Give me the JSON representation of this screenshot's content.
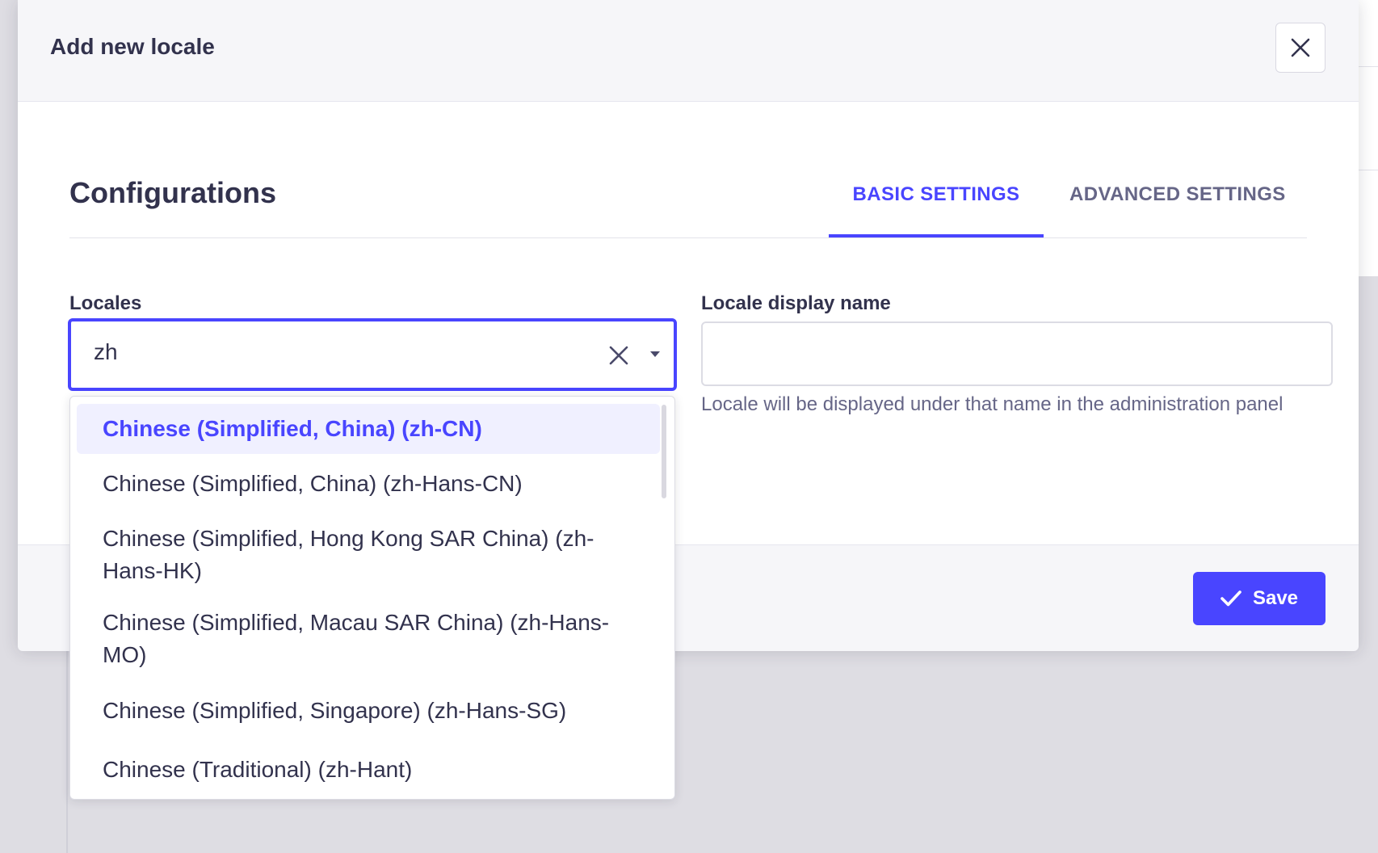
{
  "modal": {
    "title": "Add new locale"
  },
  "configurations": {
    "title": "Configurations",
    "tabs": [
      {
        "label": "BASIC SETTINGS",
        "active": true
      },
      {
        "label": "ADVANCED SETTINGS",
        "active": false
      }
    ]
  },
  "locales_field": {
    "label": "Locales",
    "value": "zh"
  },
  "display_name_field": {
    "label": "Locale display name",
    "value": "",
    "hint": "Locale will be displayed under that name in the administration panel"
  },
  "dropdown": {
    "options": [
      {
        "label": "Chinese (Simplified, China) (zh-CN)",
        "highlighted": true
      },
      {
        "label": "Chinese (Simplified, China) (zh-Hans-CN)",
        "highlighted": false
      },
      {
        "label": "Chinese (Simplified, Hong Kong SAR China) (zh-Hans-HK)",
        "highlighted": false
      },
      {
        "label": "Chinese (Simplified, Macau SAR China) (zh-Hans-MO)",
        "highlighted": false
      },
      {
        "label": "Chinese (Simplified, Singapore) (zh-Hans-SG)",
        "highlighted": false
      },
      {
        "label": "Chinese (Traditional) (zh-Hant)",
        "highlighted": false
      }
    ]
  },
  "footer": {
    "save_label": "Save"
  },
  "icons": {
    "close": "close-icon",
    "clear": "clear-icon",
    "caret": "caret-down-icon",
    "check": "check-icon"
  },
  "colors": {
    "primary": "#4945ff",
    "highlight_bg": "#f0f0ff",
    "text": "#32324d",
    "muted": "#666687"
  }
}
